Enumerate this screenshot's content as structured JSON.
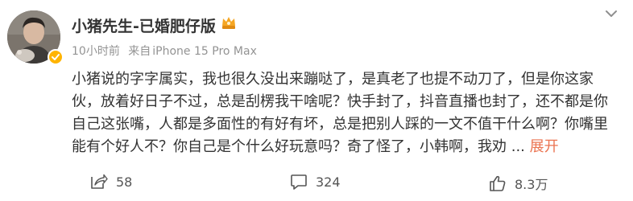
{
  "post": {
    "author": {
      "name": "小猪先生-已婚肥仔版",
      "time": "10小时前",
      "source_label": "来自",
      "device": "iPhone 15 Pro Max"
    },
    "text": "小猪说的字字属实，我也很久没出来蹦哒了，是真老了也提不动刀了，但是你这家伙，放着好日子不过，总是刮楞我干啥呢？快手封了，抖音直播也封了，还不都是你自己这张嘴，人都是多面性的有好有坏，总是把别人踩的一文不值干什么啊？你嘴里能有个好人不？你自己是个什么好玩意吗？奇了怪了，小韩啊，我劝",
    "ellipsis": "...",
    "expand_label": "展开"
  },
  "actions": {
    "share_count": "58",
    "comment_count": "324",
    "like_count": "8.3万"
  },
  "colors": {
    "accent_link": "#eb7350",
    "meta_text": "#939393",
    "verified_badge": "#ffb400"
  },
  "icons": {
    "more": "chevron-down-icon",
    "share": "share-icon",
    "comment": "comment-icon",
    "like": "thumbs-up-icon",
    "verified": "verified-badge-icon",
    "vip": "vip-badge-icon"
  }
}
